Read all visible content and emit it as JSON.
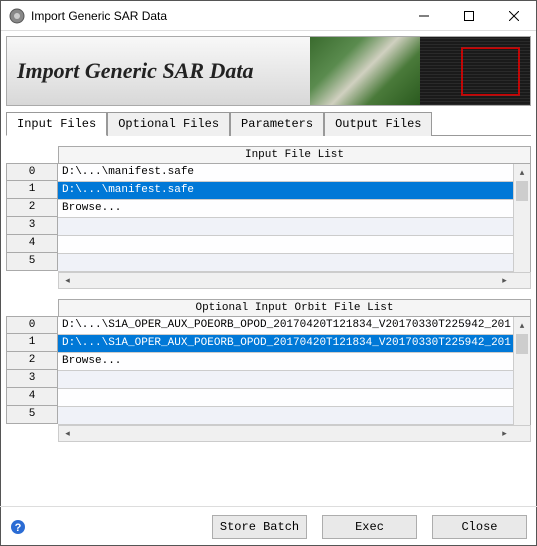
{
  "window": {
    "title": "Import Generic SAR Data"
  },
  "banner": {
    "title": "Import Generic SAR Data"
  },
  "tabs": [
    {
      "label": "Input Files",
      "active": true
    },
    {
      "label": "Optional Files",
      "active": false
    },
    {
      "label": "Parameters",
      "active": false
    },
    {
      "label": "Output Files",
      "active": false
    }
  ],
  "input_list": {
    "header": "Input File List",
    "row_numbers": [
      "0",
      "1",
      "2",
      "3",
      "4",
      "5"
    ],
    "rows": [
      {
        "text": "D:\\...\\manifest.safe",
        "selected": false
      },
      {
        "text": "D:\\...\\manifest.safe",
        "selected": true
      },
      {
        "text": "Browse...",
        "selected": false
      },
      {
        "text": "",
        "selected": false
      },
      {
        "text": "",
        "selected": false
      },
      {
        "text": "",
        "selected": false
      }
    ]
  },
  "orbit_list": {
    "header": "Optional Input Orbit File List",
    "row_numbers": [
      "0",
      "1",
      "2",
      "3",
      "4",
      "5"
    ],
    "rows": [
      {
        "text": "D:\\...\\S1A_OPER_AUX_POEORB_OPOD_20170420T121834_V20170330T225942_201",
        "selected": false
      },
      {
        "text": "D:\\...\\S1A_OPER_AUX_POEORB_OPOD_20170420T121834_V20170330T225942_201",
        "selected": true
      },
      {
        "text": "Browse...",
        "selected": false
      },
      {
        "text": "",
        "selected": false
      },
      {
        "text": "",
        "selected": false
      },
      {
        "text": "",
        "selected": false
      }
    ]
  },
  "footer": {
    "store_batch_label": "Store Batch",
    "exec_label": "Exec",
    "close_label": "Close"
  }
}
